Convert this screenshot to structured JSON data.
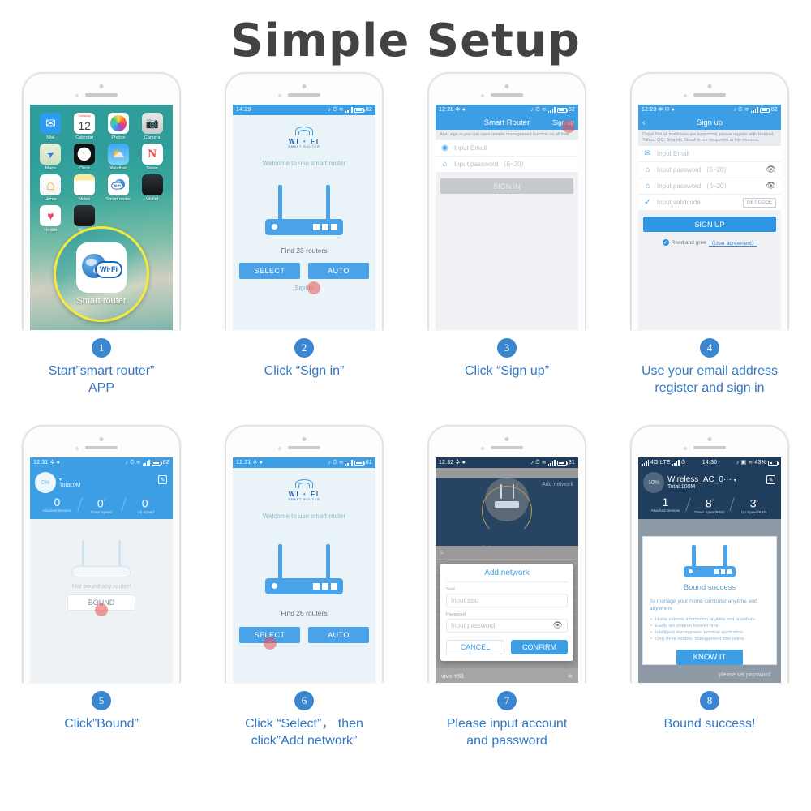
{
  "header": {
    "title": "Simple  Setup"
  },
  "steps": [
    {
      "number": "1",
      "caption": "Start”smart router”\nAPP"
    },
    {
      "number": "2",
      "caption": "Click “Sign in”"
    },
    {
      "number": "3",
      "caption": "Click “Sign up”"
    },
    {
      "number": "4",
      "caption": "Use your email address\nregister and sign in"
    },
    {
      "number": "5",
      "caption": "Click”Bound”"
    },
    {
      "number": "6",
      "caption": "Click “Select”， then\nclick”Add network”"
    },
    {
      "number": "7",
      "caption": "Please input account\nand password"
    },
    {
      "number": "8",
      "caption": "Bound success!"
    }
  ],
  "phone1": {
    "apps": [
      {
        "label": "Mail",
        "icon": "mail-icon"
      },
      {
        "label": "Calendar",
        "icon": "calendar-icon",
        "weekday": "Tuesday",
        "day": "12"
      },
      {
        "label": "Photos",
        "icon": "photos-icon"
      },
      {
        "label": "Camera",
        "icon": "camera-icon"
      },
      {
        "label": "Maps",
        "icon": "maps-icon"
      },
      {
        "label": "Clock",
        "icon": "clock-icon"
      },
      {
        "label": "Weather",
        "icon": "weather-icon"
      },
      {
        "label": "News",
        "icon": "news-icon"
      },
      {
        "label": "Home",
        "icon": "home-icon"
      },
      {
        "label": "Notes",
        "icon": "notes-icon"
      },
      {
        "label": "Smart router",
        "icon": "smart-router-icon"
      },
      {
        "label": "Wallet",
        "icon": "wallet-icon"
      },
      {
        "label": "Health",
        "icon": "health-icon"
      },
      {
        "label": "Watch",
        "icon": "watch-icon"
      }
    ],
    "magnified": {
      "label": "Smart router",
      "icon_text": "Wi·Fi"
    }
  },
  "phone2": {
    "statusbar": {
      "time": "14:29",
      "battery": "82"
    },
    "logo": {
      "word_left": "WI",
      "word_right": "FI",
      "sub": "SMART ROUTER"
    },
    "welcome": "Welcome to use smart router",
    "find": "Find 23 routers",
    "select_label": "SELECT",
    "auto_label": "AUTO",
    "signin_label": "Sign in"
  },
  "phone3": {
    "statusbar": {
      "time": "12:28",
      "battery": "82"
    },
    "title": "Smart Router",
    "signup_link": "Sign up",
    "hint": "After sign in,you can open remote management function on all time",
    "email_placeholder": "Input Email",
    "password_placeholder": "Input password （6~20）",
    "signin_button": "SIGN IN"
  },
  "phone4": {
    "statusbar": {
      "time": "12:28",
      "battery": "82"
    },
    "title": "Sign up",
    "hint": "Oops! Not all mailboxes are supported, please register with Hotmail, Yahoo, QQ, Sina etc. Gmail is not supported at this moment.",
    "email_placeholder": "Input Email",
    "password_placeholder": "Input password （6~20）",
    "password2_placeholder": "Input password （6~20）",
    "validcode_placeholder": "Input validcode",
    "getcode_label": "GET CODE",
    "signup_button": "SIGN UP",
    "agree_text": "Read and gree",
    "agreement_link": "（User agreement）"
  },
  "phone5": {
    "statusbar": {
      "time": "12:31",
      "battery": "82"
    },
    "percent": "0%",
    "total": "Total:0M",
    "stats": [
      {
        "value": "0",
        "unit": "",
        "label": "Attached Devices"
      },
      {
        "value": "0",
        "unit": "°",
        "label": "Down Speed"
      },
      {
        "value": "0",
        "unit": "•",
        "label": "Up Speed"
      }
    ],
    "not_bound": "Not bound any router!",
    "bound_button": "BOUND"
  },
  "phone6": {
    "statusbar": {
      "time": "12:31",
      "battery": "81"
    },
    "logo": {
      "word_left": "WI",
      "word_right": "FI",
      "sub": "SMART ROUTER"
    },
    "welcome": "Welcome to use smart router",
    "find": "Find 26 routers",
    "select_label": "SELECT",
    "auto_label": "AUTO"
  },
  "phone7": {
    "statusbar": {
      "time": "12:32",
      "battery": "81"
    },
    "add_network_link": "Add network",
    "fail_text": "Failed to connect to ad—",
    "dialog": {
      "title": "Add network",
      "ssid_label": "Ssid",
      "ssid_placeholder": "Input ssid",
      "password_label": "Password",
      "password_placeholder": "Input password",
      "cancel_label": "CANCEL",
      "confirm_label": "CONFIRM"
    },
    "device_name": "vivo Y51"
  },
  "phone8": {
    "statusbar": {
      "carrier": "4G LTE",
      "time": "14:36",
      "battery": "43%"
    },
    "percent": "10%",
    "ssid": "Wireless_AC_0···",
    "total": "Total:100M",
    "stats": [
      {
        "value": "1",
        "unit": "",
        "label": "Attached Devices"
      },
      {
        "value": "8",
        "unit": "°",
        "label": "Down Speed/KB/s"
      },
      {
        "value": "3",
        "unit": "•",
        "label": "Up Speed/KB/s"
      }
    ],
    "success_title": "Bound success",
    "success_desc": "To manage your home computer anytime and anywhere",
    "bullets": [
      "Home network information anytime and anywhere",
      "Easily set children Internet time",
      "Intelligent management terminal application",
      "Only three models, management time online"
    ],
    "know_button": "KNOW IT",
    "set_password": "please set password"
  },
  "colors": {
    "accent": "#3c9ee5",
    "caption": "#3277c4",
    "title": "#434343",
    "highlight": "#f3ea3c"
  }
}
